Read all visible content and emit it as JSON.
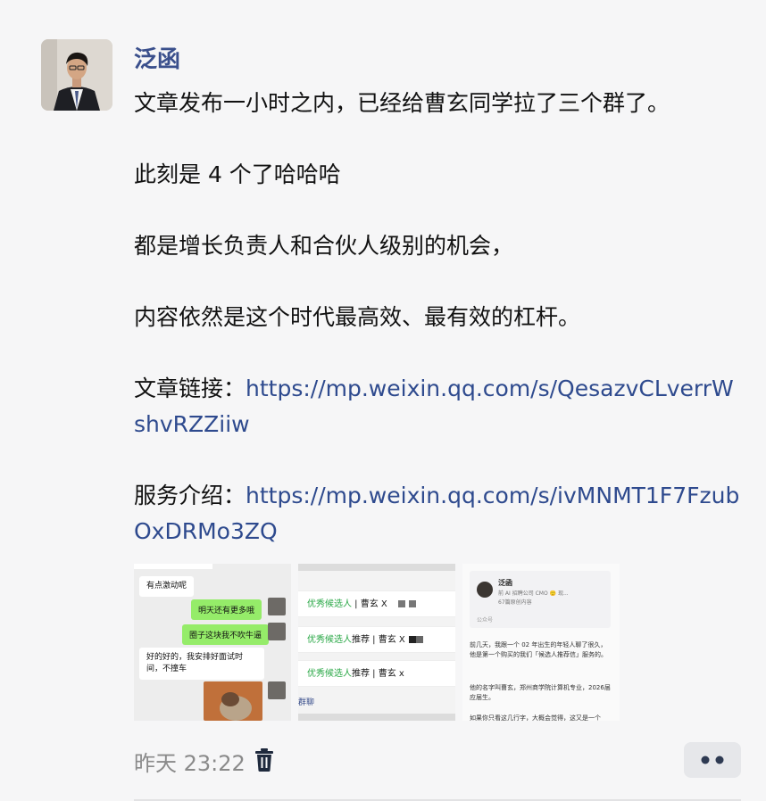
{
  "post": {
    "author": "泛函",
    "paragraphs": [
      "文章发布一小时之内，已经给曹玄同学拉了三个群了。",
      "此刻是 4 个了哈哈哈",
      "都是增长负责人和合伙人级别的机会，",
      "内容依然是这个时代最高效、最有效的杠杆。"
    ],
    "article_link_label": "文章链接：",
    "article_link_url": "https://mp.weixin.qq.com/s/QesazvCLverrWshvRZZiiw",
    "service_link_label": "服务介绍：",
    "service_link_url": "https://mp.weixin.qq.com/s/ivMNMT1F7FzubOxDRMo3ZQ",
    "timestamp": "昨天 23:22"
  },
  "thumb1": {
    "msg_top": "有点激动呢",
    "msg_green_1": "明天还有更多哦",
    "msg_green_2": "圈子这块我不吹牛逼",
    "msg_white": "好的好的，我安排好面试时间，不撞车"
  },
  "thumb2": {
    "row1_green": "优秀候选人",
    "row1_rest": " | 曹玄 X",
    "row2_green": "优秀候选人",
    "row2_rest": "推荐 | 曹玄 X",
    "row3_green": "优秀候选人",
    "row3_rest": "推荐 | 曹玄 x",
    "footer": "群聊"
  },
  "thumb3": {
    "card_name": "泛函",
    "card_sub": "前 AI 招聘公司 CMO 🙂 现...",
    "card_count": "67篇原创内容",
    "card_tag": "公众号",
    "body_p1": "前几天，我跟一个 02 年出生的年轻人聊了很久，他是第一个购买的我们「候选人推荐信」服务的。",
    "body_p2": "他的名字叫曹玄，郑州商学院计算机专业，2026届应届生。",
    "body_p3": "如果你只看这几行字，大概会觉得，这又是一个"
  },
  "icons": {
    "trash": "trash-icon",
    "more": "more-dots-icon"
  },
  "colors": {
    "author": "#3a4f8c",
    "link": "#2e4a8e",
    "meta": "#8a8a8a",
    "wechat_green": "#95ec69"
  }
}
